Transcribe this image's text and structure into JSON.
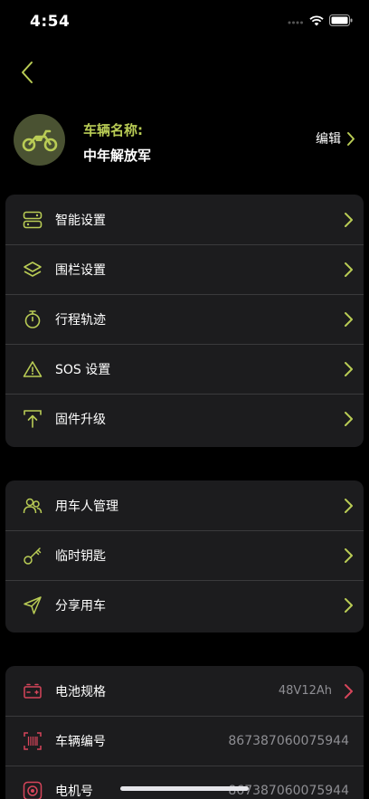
{
  "status_bar": {
    "time": "4:54"
  },
  "vehicle": {
    "name_label": "车辆名称:",
    "name": "中年解放军",
    "edit_label": "编辑"
  },
  "colors": {
    "accent": "#b9cc55",
    "alert": "#d6455a",
    "card": "#1c1c1e"
  },
  "group1": [
    {
      "label": "智能设置",
      "icon": "toggle-icon"
    },
    {
      "label": "围栏设置",
      "icon": "layers-icon"
    },
    {
      "label": "行程轨迹",
      "icon": "stopwatch-icon"
    },
    {
      "label": "SOS 设置",
      "icon": "warning-icon"
    },
    {
      "label": "固件升级",
      "icon": "upload-icon"
    }
  ],
  "group2": [
    {
      "label": "用车人管理",
      "icon": "users-icon"
    },
    {
      "label": "临时钥匙",
      "icon": "key-icon"
    },
    {
      "label": "分享用车",
      "icon": "send-icon"
    }
  ],
  "group3": [
    {
      "label": "电池规格",
      "icon": "battery-icon",
      "value": "48V12Ah"
    },
    {
      "label": "车辆编号",
      "icon": "barcode-icon",
      "value": "867387060075944"
    },
    {
      "label": "电机号",
      "icon": "motor-icon",
      "value": "867387060075944"
    }
  ]
}
